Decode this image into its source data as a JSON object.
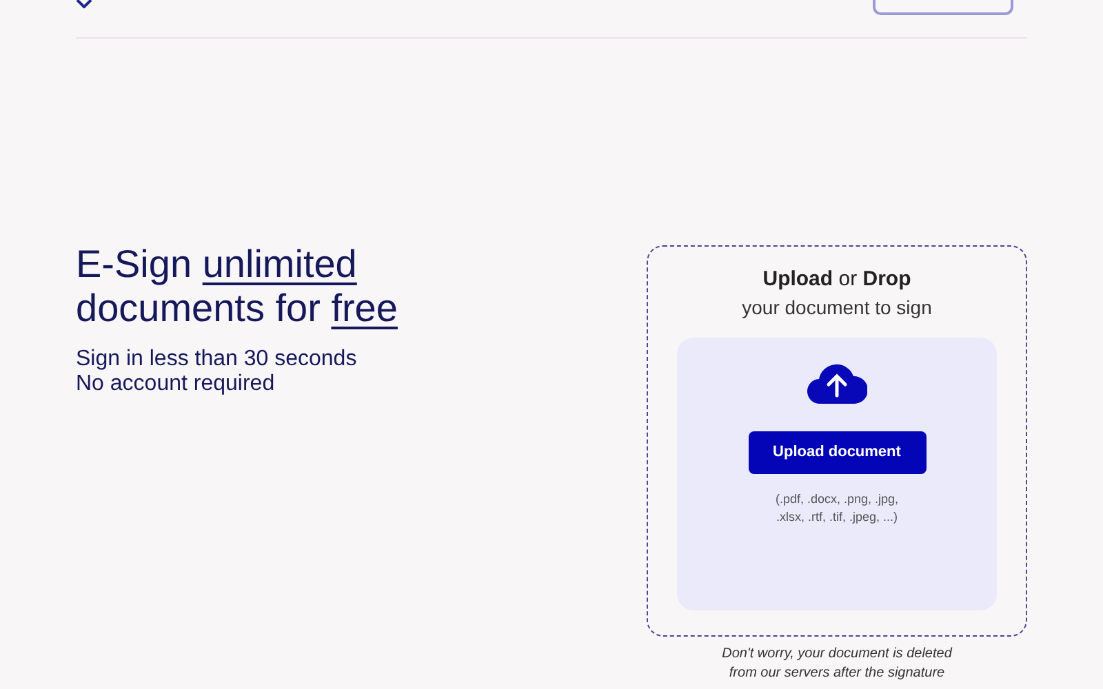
{
  "hero": {
    "heading": [
      {
        "text": "E-Sign ",
        "underlined": false
      },
      {
        "text": "unlimited",
        "underlined": true
      },
      {
        "text": "documents for ",
        "underlined": false
      },
      {
        "text": "free",
        "underlined": true
      }
    ],
    "lines": [
      "Sign in less than 30 seconds",
      "No account required"
    ]
  },
  "upload": {
    "title": "**Upload** or **Drop**",
    "subtitle": "your document to sign",
    "button": "Upload document",
    "formats": [
      "(.pdf, .docx, .png, .jpg,",
      ".xlsx, .rtf, .tif, .jpeg, ...)"
    ],
    "note": [
      "Don't worry, your document is deleted",
      "from our servers after the signature"
    ]
  }
}
